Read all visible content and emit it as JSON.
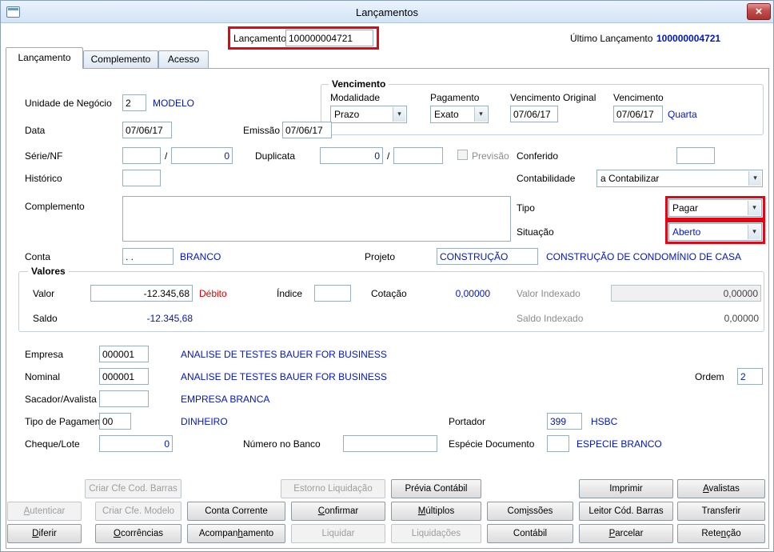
{
  "window": {
    "title": "Lançamentos",
    "close_glyph": "×"
  },
  "header": {
    "lancamento_label": "Lançamento",
    "lancamento_value": "100000004721",
    "ultimo_label": "Último Lançamento",
    "ultimo_value": "100000004721"
  },
  "tabs": [
    {
      "label": "Lançamento",
      "active": true
    },
    {
      "label": "Complemento",
      "active": false
    },
    {
      "label": "Acesso",
      "active": false
    }
  ],
  "form": {
    "unidade_label": "Unidade de Negócio",
    "unidade_value": "2",
    "unidade_desc": "MODELO",
    "venc_title": "Vencimento",
    "modalidade_label": "Modalidade",
    "modalidade_value": "Prazo",
    "pagamento_label": "Pagamento",
    "pagamento_value": "Exato",
    "venc_orig_label": "Vencimento Original",
    "venc_orig_value": "07/06/17",
    "venc_label": "Vencimento",
    "venc_value": "07/06/17",
    "venc_desc": "Quarta",
    "data_label": "Data",
    "data_value": "07/06/17",
    "emissao_label": "Emissão",
    "emissao_value": "07/06/17",
    "serie_label": "Série/NF",
    "serie_value1": "",
    "serie_sep": "/",
    "serie_value2": "0",
    "duplicata_label": "Duplicata",
    "duplicata_value1": "0",
    "duplicata_sep": "/",
    "duplicata_value2": "",
    "previsao_label": "Previsão",
    "previsao_checked": false,
    "conferido_label": "Conferido",
    "conferido_value": "",
    "historico_label": "Histórico",
    "historico_value": "",
    "contab_label": "Contabilidade",
    "contab_value": "a Contabilizar",
    "complemento_label": "Complemento",
    "complemento_value": "",
    "tipo_label": "Tipo",
    "tipo_value": "Pagar",
    "situacao_label": "Situação",
    "situacao_value": "Aberto",
    "conta_label": "Conta",
    "conta_value": ". .",
    "conta_desc": "BRANCO",
    "projeto_label": "Projeto",
    "projeto_value": "CONSTRUÇÃO",
    "projeto_desc": "CONSTRUÇÃO DE CONDOMÍNIO DE CASA",
    "valores_title": "Valores",
    "valor_label": "Valor",
    "valor_value": "-12.345,68",
    "valor_flag": "Débito",
    "indice_label": "Índice",
    "indice_value": "",
    "cotacao_label": "Cotação",
    "cotacao_value": "0,00000",
    "valor_idx_label": "Valor Indexado",
    "valor_idx_value": "0,00000",
    "saldo_label": "Saldo",
    "saldo_value": "-12.345,68",
    "saldo_idx_label": "Saldo Indexado",
    "saldo_idx_value": "0,00000",
    "empresa_label": "Empresa",
    "empresa_value": "000001",
    "empresa_desc": "ANALISE DE TESTES BAUER FOR BUSINESS",
    "nominal_label": "Nominal",
    "nominal_value": "000001",
    "nominal_desc": "ANALISE DE TESTES BAUER FOR BUSINESS",
    "ordem_label": "Ordem",
    "ordem_value": "2",
    "sacador_label": "Sacador/Avalista",
    "sacador_value": "",
    "sacador_desc": "EMPRESA BRANCA",
    "tipo_pag_label": "Tipo de Pagamento",
    "tipo_pag_value": "00",
    "tipo_pag_desc": "DINHEIRO",
    "portador_label": "Portador",
    "portador_value": "399",
    "portador_desc": "HSBC",
    "cheque_label": "Cheque/Lote",
    "cheque_value": "0",
    "num_banco_label": "Número no Banco",
    "num_banco_value": "",
    "especie_label": "Espécie Documento",
    "especie_value": "",
    "especie_desc": "ESPECIE BRANCO"
  },
  "buttons": {
    "criar_cod_barras": {
      "label": "Criar Cfe Cod. Barras",
      "disabled": true
    },
    "estorno": {
      "label": "Estorno Liquidação",
      "disabled": true
    },
    "previa": {
      "label": "Prévia Contábil"
    },
    "imprimir": {
      "label": "Imprimir"
    },
    "avalistas": {
      "label": "Avalistas",
      "mnemonic": 0
    },
    "autenticar": {
      "label": "Autenticar",
      "disabled": true,
      "mnemonic": 0
    },
    "criar_modelo": {
      "label": "Criar Cfe. Modelo",
      "disabled": true
    },
    "conta_corrente": {
      "label": "Conta Corrente"
    },
    "confirmar": {
      "label": "Confirmar",
      "mnemonic": 0
    },
    "multiplos": {
      "label": "Múltiplos",
      "mnemonic": 0
    },
    "comissoes": {
      "label": "Comissões",
      "mnemonic": 3
    },
    "leitor": {
      "label": "Leitor Cód. Barras"
    },
    "transferir": {
      "label": "Transferir"
    },
    "diferir": {
      "label": "Diferir",
      "mnemonic": 0
    },
    "ocorrencias": {
      "label": "Ocorrências",
      "mnemonic": 0
    },
    "acompanhamento": {
      "label": "Acompanhamento",
      "mnemonic": 7
    },
    "liquidar": {
      "label": "Liquidar",
      "disabled": true
    },
    "liquidacoes": {
      "label": "Liquidações",
      "disabled": true
    },
    "contabil": {
      "label": "Contábil"
    },
    "parcelar": {
      "label": "Parcelar",
      "mnemonic": 0
    },
    "retencao": {
      "label": "Retenção",
      "mnemonic": 4
    }
  },
  "colors": {
    "value_blue": "#0014c8",
    "flag_red": "#d80000",
    "annotation_red": "#e30613"
  }
}
